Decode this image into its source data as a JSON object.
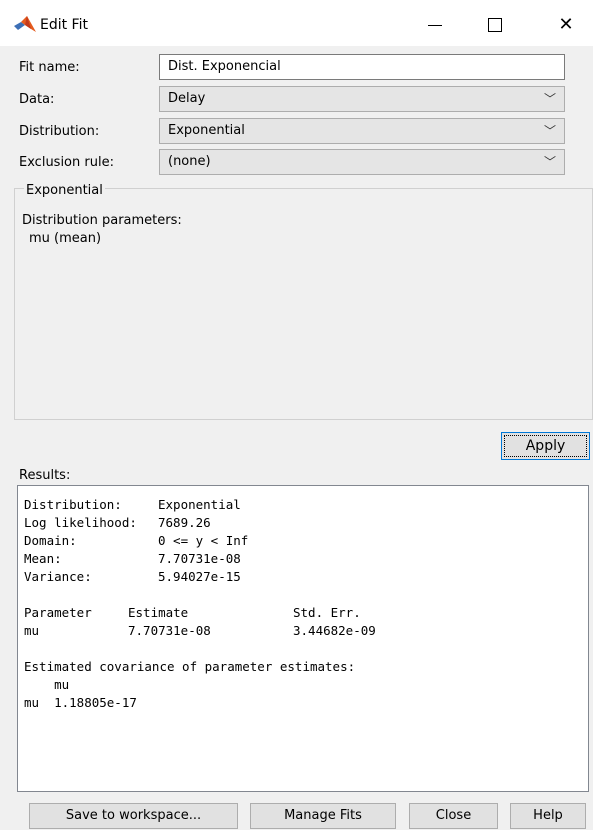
{
  "window": {
    "title": "Edit Fit",
    "icon": "matlab-logo",
    "controls": {
      "minimize": "minimize-icon",
      "maximize": "maximize-icon",
      "close": "close-icon"
    }
  },
  "form": {
    "fit_name_label": "Fit name:",
    "fit_name_value": "Dist. Exponencial",
    "data_label": "Data:",
    "data_value": "Delay",
    "distribution_label": "Distribution:",
    "distribution_value": "Exponential",
    "exclusion_label": "Exclusion rule:",
    "exclusion_value": "(none)"
  },
  "group": {
    "title": "Exponential",
    "subtitle": "Distribution parameters:",
    "param": "mu (mean)"
  },
  "apply_label": "Apply",
  "results": {
    "label": "Results:",
    "lines": [
      [
        "Distribution:",
        "Exponential",
        ""
      ],
      [
        "Log likelihood:",
        "7689.26",
        ""
      ],
      [
        "Domain:",
        "0 <= y < Inf",
        ""
      ],
      [
        "Mean:",
        "7.70731e-08",
        ""
      ],
      [
        "Variance:",
        "5.94027e-15",
        ""
      ],
      [
        "",
        "",
        ""
      ],
      [
        "Parameter",
        "Estimate",
        "Std. Err."
      ],
      [
        "mu",
        "7.70731e-08",
        "3.44682e-09"
      ],
      [
        "",
        "",
        ""
      ],
      [
        "Estimated covariance of parameter estimates:",
        "",
        ""
      ],
      [
        "    mu",
        "",
        ""
      ],
      [
        "mu  1.18805e-17",
        "",
        ""
      ]
    ]
  },
  "buttons": {
    "save": "Save to workspace...",
    "manage": "Manage Fits",
    "close": "Close",
    "help": "Help"
  }
}
